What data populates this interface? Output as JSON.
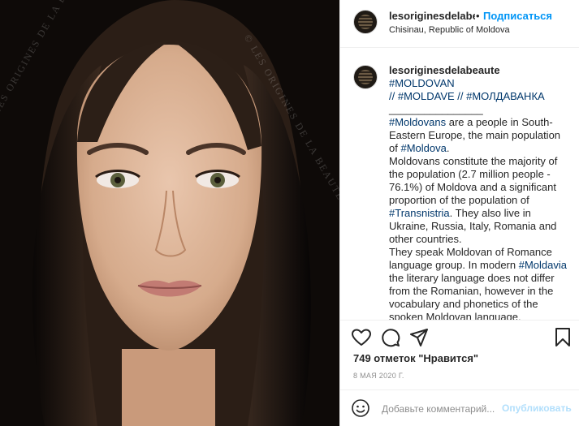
{
  "photo": {
    "watermark": "© LES ORIGINES DE LA BEAUTÉ",
    "alt_subject": "portrait-photo"
  },
  "header": {
    "username": "lesoriginesdelabeaute",
    "separator": "•",
    "follow_label": "Подписаться",
    "location": "Chisinau, Republic of Moldova"
  },
  "caption": {
    "username": "lesoriginesdelabeaute",
    "line1_tags": "#MOLDOVAN",
    "line2": "// #MOLDAVE // #МОЛДАВАНКА",
    "divider": "________________",
    "tag_moldovans": "#Moldovans",
    "text_a": " are a people in South-Eastern Europe, the main population of ",
    "tag_moldova": "#Moldova",
    "text_b": ".\nMoldovans constitute the majority of the population (2.7 million people - 76.1%) of Moldova and a significant proportion of the population of ",
    "tag_transnistria": "#Transnistria",
    "text_c": ". They also live in Ukraine, Russia, Italy, Romania and other countries.\nThey speak Moldovan of Romance language group. In modern ",
    "tag_moldavia": "#Moldavia",
    "text_d": " the literary language does not differ from the Romanian, however in the vocabulary and phonetics of the spoken Moldovan language, especially some of its dialects, there are"
  },
  "actions": {
    "like_icon": "heart-icon",
    "comment_icon": "comment-bubble-icon",
    "share_icon": "paper-plane-icon",
    "save_icon": "bookmark-icon"
  },
  "likes_text": "749 отметок \"Нравится\"",
  "date_text": "8 МАЯ 2020 Г.",
  "comment": {
    "emoji_icon": "smiley-icon",
    "placeholder": "Добавьте комментарий...",
    "post_label": "Опубликовать"
  },
  "colors": {
    "accent": "#0095f6",
    "hashtag": "#00376b",
    "post_disabled": "#b2dffc",
    "muted": "#8e8e8e"
  }
}
